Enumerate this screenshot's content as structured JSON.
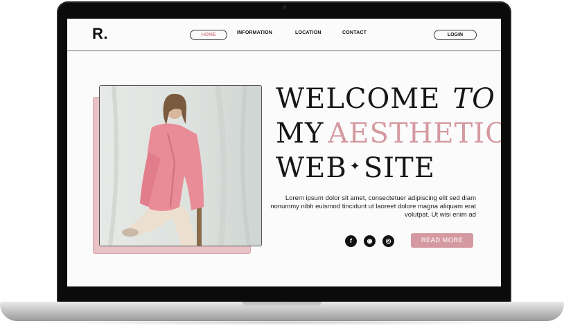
{
  "brand": {
    "logo": "R."
  },
  "nav": {
    "home": "HOME",
    "information": "INFORMATION",
    "location": "LOCATION",
    "contact": "CONTACT",
    "login": "LOGIN"
  },
  "hero": {
    "line1_a": "WELCOME",
    "line1_b": "TO",
    "line2_a": "MY",
    "line2_b": "AESTHETIC",
    "line3_a": "WEB",
    "line3_star": "✦",
    "line3_b": "SITE",
    "body": "Lorem ipsum dolor sit amet, consectetuer adipiscing elit sed diam nonummy nibh euismod tincidunt ut laoreet dolore magna aliquam erat volutpat. Ut wisi enim ad",
    "cta": "READ MORE"
  },
  "social": {
    "facebook_glyph": "f",
    "location_glyph": "◉",
    "instagram_glyph": "◎"
  },
  "colors": {
    "accent": "#d59aa1",
    "accent_back": "#e9c2c8",
    "text": "#161616"
  },
  "icons": [
    "facebook-icon",
    "location-pin-icon",
    "instagram-icon",
    "star-icon"
  ]
}
